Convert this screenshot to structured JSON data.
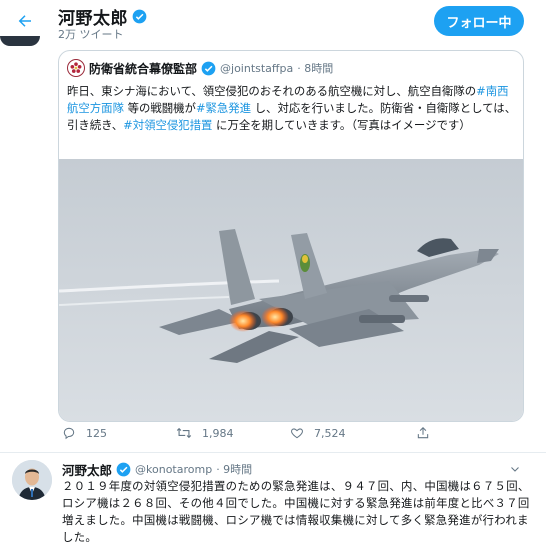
{
  "header": {
    "name": "河野太郎",
    "tweet_count": "2万 ツイート",
    "follow_label": "フォロー中"
  },
  "quote": {
    "name": "防衛省統合幕僚監部",
    "handle": "@jointstaffpa",
    "time": "· 8時間",
    "text_parts": [
      {
        "t": "昨日、東シナ海において、領空侵犯のおそれのある航空機に対し、航空自衛隊の",
        "h": false
      },
      {
        "t": "#南西航空方面隊",
        "h": true
      },
      {
        "t": " 等の戦闘機が",
        "h": false
      },
      {
        "t": "#緊急発進",
        "h": true
      },
      {
        "t": " し、対応を行いました。防衛省・自衛隊としては、引き続き、",
        "h": false
      },
      {
        "t": "#対領空侵犯措置",
        "h": true
      },
      {
        "t": " に万全を期していきます。（写真はイメージです）",
        "h": false
      }
    ],
    "image_alt": "F-15J fighter jet with afterburners"
  },
  "actions": {
    "reply_count": "125",
    "retweet_count": "1,984",
    "like_count": "7,524"
  },
  "reply": {
    "name": "河野太郎",
    "handle": "@konotaromp",
    "time": "· 9時間",
    "text": "２０１９年度の対領空侵犯措置のための緊急発進は、９４７回、内、中国機は６７５回、ロシア機は２６８回、その他４回でした。中国機に対する緊急発進は前年度と比べ３７回増えました。中国機は戦闘機、ロシア機では情報収集機に対して多く緊急発進が行われました。"
  },
  "colors": {
    "accent": "#1da1f2",
    "hashtag": "#1b95e0",
    "muted": "#657786",
    "border": "#ccd6dd"
  }
}
